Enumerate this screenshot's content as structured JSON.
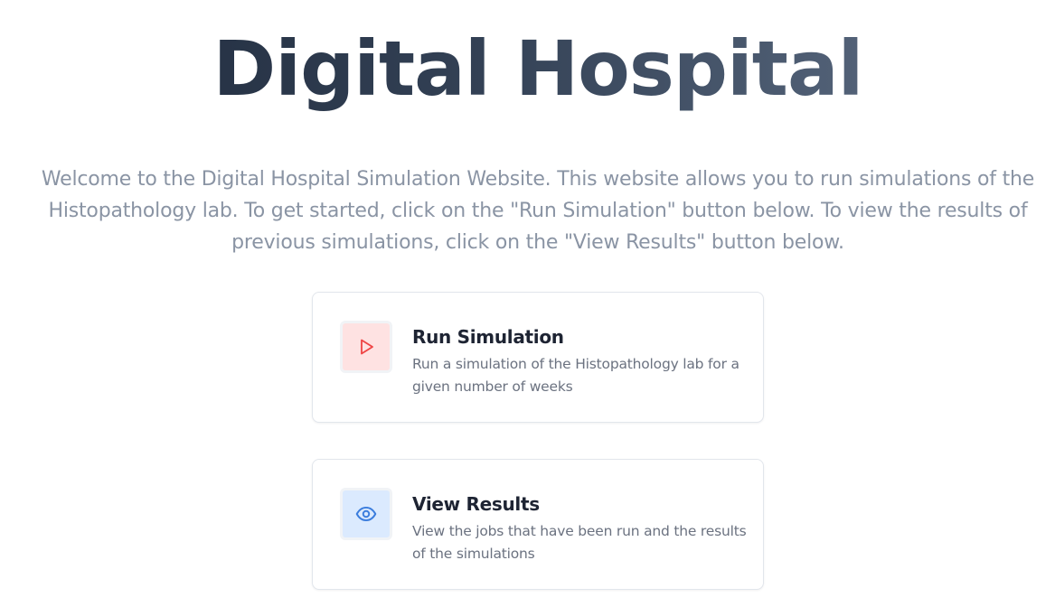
{
  "header": {
    "title": "Digital Hospital"
  },
  "intro": {
    "text": "Welcome to the Digital Hospital Simulation Website. This website allows you to run simulations of the Histopathology lab. To get started, click on the \"Run Simulation\" button below. To view the results of previous simulations, click on the \"View Results\" button below."
  },
  "cards": {
    "run": {
      "title": "Run Simulation",
      "description": "Run a simulation of the Histopathology lab for a given number of weeks",
      "icon": "play-icon",
      "icon_color": "#ef4444",
      "icon_bg": "#fee2e2"
    },
    "view": {
      "title": "View Results",
      "description": "View the jobs that have been run and the results of the simulations",
      "icon": "eye-icon",
      "icon_color": "#3b7ddd",
      "icon_bg": "#dbeafe"
    }
  }
}
